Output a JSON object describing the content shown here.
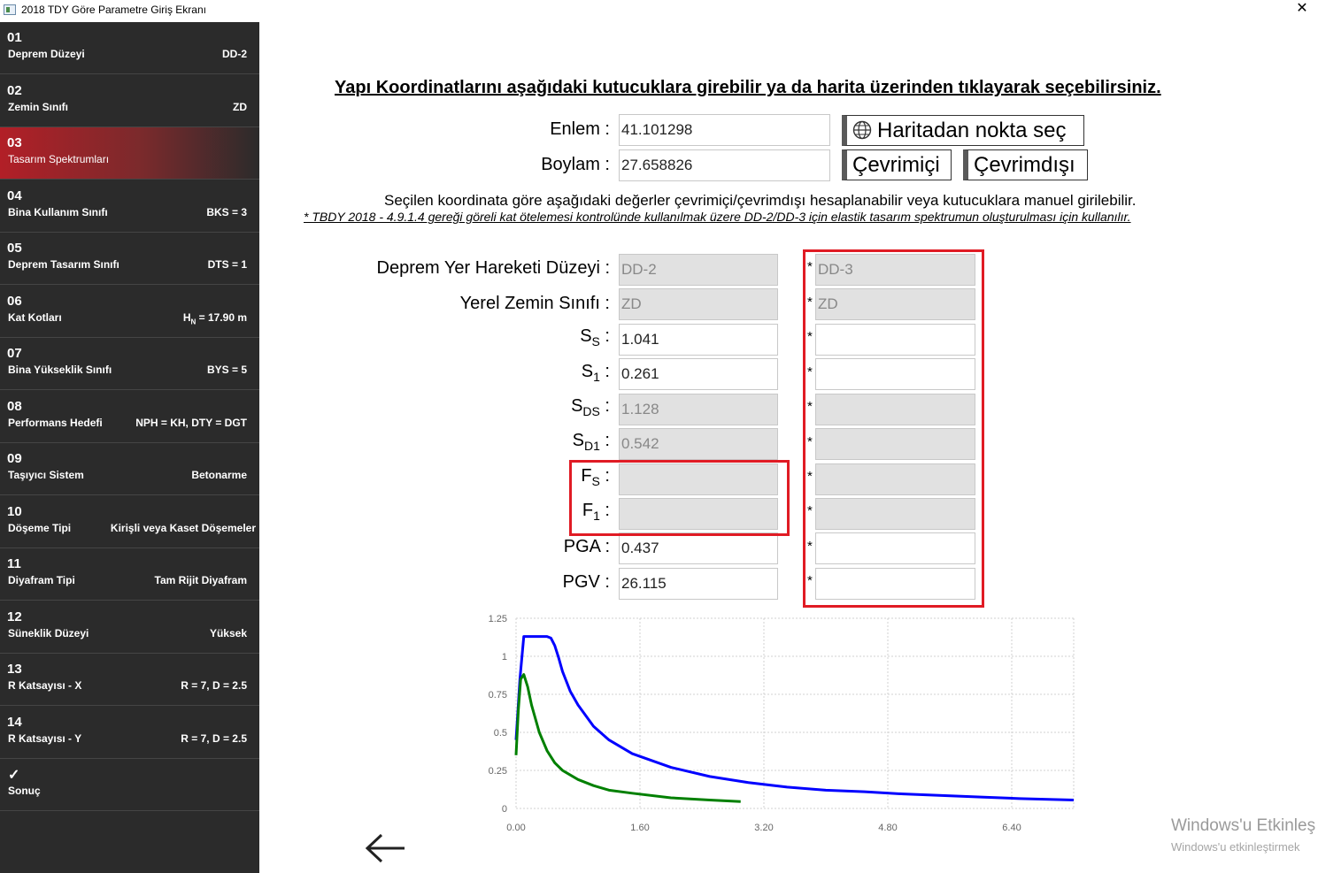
{
  "window": {
    "title": "2018 TDY Göre Parametre Giriş Ekranı",
    "close_glyph": "✕"
  },
  "sidebar": {
    "items": [
      {
        "num": "01",
        "name": "Deprem Düzeyi",
        "value": "DD-2"
      },
      {
        "num": "02",
        "name": "Zemin Sınıfı",
        "value": "ZD"
      },
      {
        "num": "03",
        "name": "Tasarım Spektrumları",
        "value": "",
        "active": true
      },
      {
        "num": "04",
        "name": "Bina Kullanım Sınıfı",
        "value": "BKS = 3"
      },
      {
        "num": "05",
        "name": "Deprem Tasarım Sınıfı",
        "value": "DTS = 1"
      },
      {
        "num": "06",
        "name": "Kat Kotları",
        "value_main": "H",
        "value_sub": "N",
        "value_rest": " = 17.90 m"
      },
      {
        "num": "07",
        "name": "Bina Yükseklik Sınıfı",
        "value": "BYS = 5"
      },
      {
        "num": "08",
        "name": "Performans Hedefi",
        "value": "NPH = KH, DTY = DGT"
      },
      {
        "num": "09",
        "name": "Taşıyıcı Sistem",
        "value": "Betonarme"
      },
      {
        "num": "10",
        "name": "Döşeme Tipi",
        "value": "Kirişli veya Kaset Döşemeler"
      },
      {
        "num": "11",
        "name": "Diyafram Tipi",
        "value": "Tam Rijit Diyafram"
      },
      {
        "num": "12",
        "name": "Süneklik Düzeyi",
        "value": "Yüksek"
      },
      {
        "num": "13",
        "name": "R Katsayısı - X",
        "value": "R = 7, D = 2.5"
      },
      {
        "num": "14",
        "name": "R Katsayısı - Y",
        "value": "R = 7, D = 2.5"
      },
      {
        "num": "✓",
        "name": "Sonuç",
        "value": ""
      }
    ]
  },
  "main": {
    "heading": "Yapı Koordinatlarını aşağıdaki kutucuklara girebilir ya da harita üzerinden tıklayarak seçebilirsiniz.",
    "enlem_label": "Enlem :",
    "enlem_value": "41.101298",
    "boylam_label": "Boylam :",
    "boylam_value": "27.658826",
    "map_button": "Haritadan nokta seç",
    "online_button": "Çevrimiçi",
    "offline_button": "Çevrimdışı",
    "info_text": "Seçilen koordinata göre aşağıdaki değerler çevrimiçi/çevrimdışı hesaplanabilir veya kutucuklara manuel girilebilir.",
    "note_text": "* TBDY 2018 - 4.9.1.4 gereği göreli kat ötelemesi kontrolünde kullanılmak üzere DD-2/DD-3 için elastik tasarım spektrumun oluşturulması için kullanılır.",
    "star": "*",
    "params": [
      {
        "label": "Deprem Yer Hareketi Düzeyi :",
        "dd2": "DD-2",
        "dd3": "DD-3",
        "dd2_disabled": true,
        "dd3_disabled": true
      },
      {
        "label": "Yerel Zemin Sınıfı :",
        "dd2": "ZD",
        "dd3": "ZD",
        "dd2_disabled": true,
        "dd3_disabled": true
      },
      {
        "label_main": "S",
        "label_sub": "S",
        "label_tail": " :",
        "dd2": "1.041",
        "dd3": "",
        "dd2_disabled": false,
        "dd3_disabled": false
      },
      {
        "label_main": "S",
        "label_sub": "1",
        "label_tail": " :",
        "dd2": "0.261",
        "dd3": "",
        "dd2_disabled": false,
        "dd3_disabled": false
      },
      {
        "label_main": "S",
        "label_sub": "DS",
        "label_tail": " :",
        "dd2": "1.128",
        "dd3": "",
        "dd2_disabled": true,
        "dd3_disabled": true
      },
      {
        "label_main": "S",
        "label_sub": "D1",
        "label_tail": " :",
        "dd2": "0.542",
        "dd3": "",
        "dd2_disabled": true,
        "dd3_disabled": true
      },
      {
        "label_main": "F",
        "label_sub": "S",
        "label_tail": " :",
        "dd2": "",
        "dd3": "",
        "dd2_disabled": true,
        "dd3_disabled": true
      },
      {
        "label_main": "F",
        "label_sub": "1",
        "label_tail": " :",
        "dd2": "",
        "dd3": "",
        "dd2_disabled": true,
        "dd3_disabled": true
      },
      {
        "label": "PGA :",
        "dd2": "0.437",
        "dd3": "",
        "dd2_disabled": false,
        "dd3_disabled": false
      },
      {
        "label": "PGV :",
        "dd2": "26.115",
        "dd3": "",
        "dd2_disabled": false,
        "dd3_disabled": false
      }
    ],
    "highlight_color": "#e01b24",
    "back_icon": "arrow-left-icon"
  },
  "chart_data": {
    "type": "line",
    "title": "",
    "xlabel": "",
    "ylabel": "",
    "xlim": [
      0,
      7.2
    ],
    "ylim": [
      0,
      1.25
    ],
    "xticks": [
      "0.00",
      "1.60",
      "3.20",
      "4.80",
      "6.40"
    ],
    "xtick_values": [
      0,
      1.6,
      3.2,
      4.8,
      6.4
    ],
    "yticks": [
      "0",
      "0.25",
      "0.5",
      "0.75",
      "1",
      "1.25"
    ],
    "ytick_values": [
      0,
      0.25,
      0.5,
      0.75,
      1,
      1.25
    ],
    "grid": true,
    "series": [
      {
        "color": "#0000ff",
        "x": [
          0,
          0.05,
          0.1,
          0.2,
          0.3,
          0.4,
          0.45,
          0.5,
          0.55,
          0.6,
          0.7,
          0.8,
          1.0,
          1.2,
          1.5,
          2.0,
          2.5,
          3.0,
          3.5,
          4.0,
          4.5,
          5.0,
          5.5,
          6.0,
          6.5,
          7.2
        ],
        "y": [
          0.45,
          0.85,
          1.13,
          1.13,
          1.13,
          1.13,
          1.12,
          1.07,
          0.99,
          0.9,
          0.77,
          0.68,
          0.54,
          0.45,
          0.36,
          0.27,
          0.21,
          0.17,
          0.14,
          0.12,
          0.11,
          0.095,
          0.085,
          0.075,
          0.065,
          0.055
        ]
      },
      {
        "color": "#008000",
        "x": [
          0,
          0.03,
          0.06,
          0.1,
          0.15,
          0.2,
          0.3,
          0.4,
          0.5,
          0.6,
          0.8,
          1.0,
          1.2,
          1.5,
          2.0,
          2.5,
          2.9
        ],
        "y": [
          0.35,
          0.65,
          0.85,
          0.88,
          0.8,
          0.68,
          0.5,
          0.38,
          0.3,
          0.25,
          0.19,
          0.15,
          0.12,
          0.1,
          0.07,
          0.055,
          0.045
        ]
      }
    ]
  },
  "watermark": {
    "line1": "Windows'u Etkinleş",
    "line2": "Windows'u etkinleştirmek"
  }
}
